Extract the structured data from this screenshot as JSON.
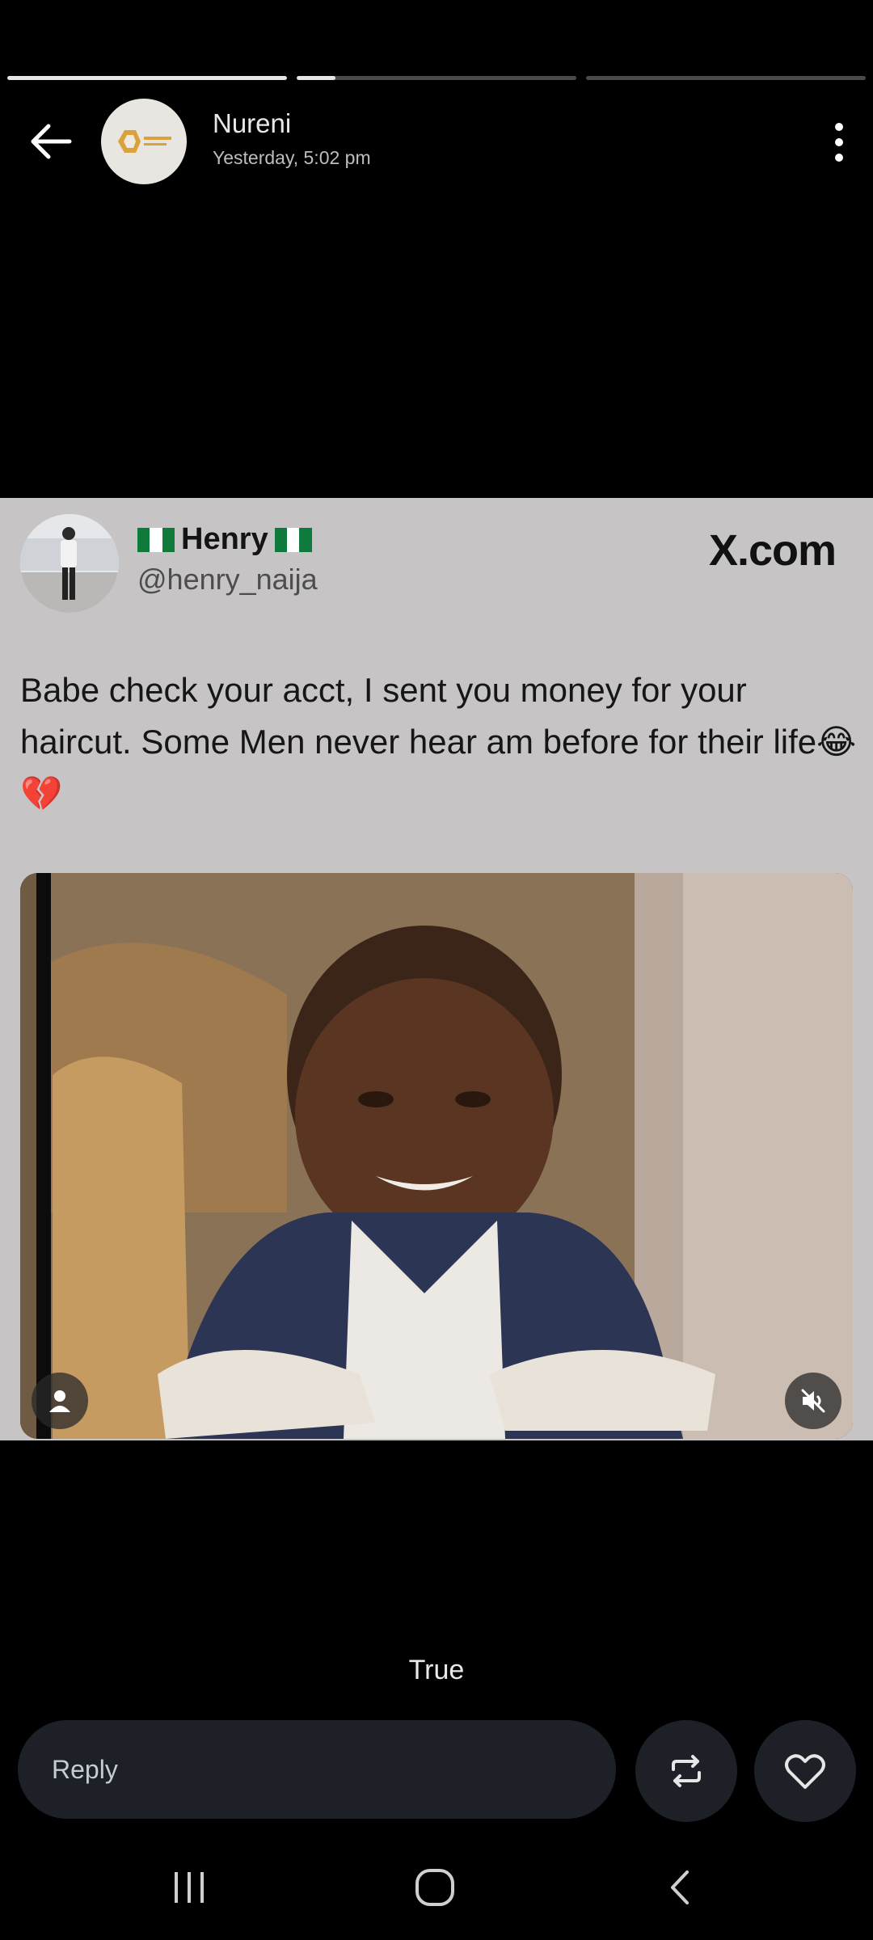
{
  "status": {
    "progress_segments": [
      1.0,
      0.14,
      0.0
    ]
  },
  "header": {
    "name": "Nureni",
    "time": "Yesterday, 5:02 pm",
    "back_icon": "back-arrow-icon",
    "menu_icon": "more-vert-icon"
  },
  "post": {
    "display_name": "Henry",
    "handle": "@henry_naija",
    "source": "X.com",
    "text": "Babe check your acct, I sent you money for your haircut. Some Men never hear am before for their life😂💔"
  },
  "caption": "True",
  "actions": {
    "reply_placeholder": "Reply",
    "repost_icon": "repost-icon",
    "like_icon": "heart-icon"
  },
  "colors": {
    "background": "#000000",
    "card": "#c6c4c5",
    "action_bg": "#1d2127",
    "flag_green": "#0f7a3c"
  }
}
